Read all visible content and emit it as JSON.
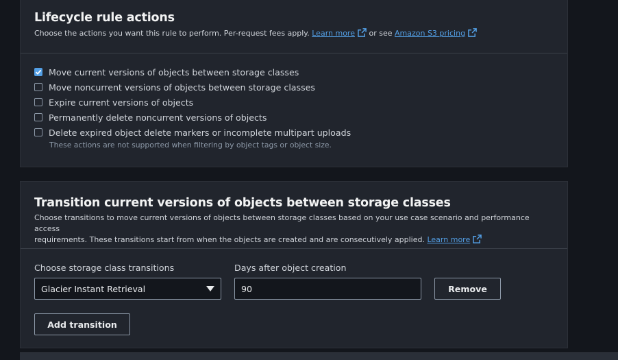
{
  "actions": {
    "title": "Lifecycle rule actions",
    "description_prefix": "Choose the actions you want this rule to perform. Per-request fees apply. ",
    "learn_more": "Learn more",
    "or_see": " or see ",
    "pricing_link": "Amazon S3 pricing",
    "options": [
      {
        "label": "Move current versions of objects between storage classes",
        "checked": true
      },
      {
        "label": "Move noncurrent versions of objects between storage classes",
        "checked": false
      },
      {
        "label": "Expire current versions of objects",
        "checked": false
      },
      {
        "label": "Permanently delete noncurrent versions of objects",
        "checked": false
      },
      {
        "label": "Delete expired object delete markers or incomplete multipart uploads",
        "checked": false
      }
    ],
    "hint": "These actions are not supported when filtering by object tags or object size."
  },
  "transition": {
    "title": "Transition current versions of objects between storage classes",
    "description_line1": "Choose transitions to move current versions of objects between storage classes based on your use case scenario and performance access",
    "description_line2": "requirements. These transitions start from when the objects are created and are consecutively applied. ",
    "learn_more": "Learn more",
    "storage_class_label": "Choose storage class transitions",
    "storage_class_value": "Glacier Instant Retrieval",
    "days_label": "Days after object creation",
    "days_value": "90",
    "remove_label": "Remove",
    "add_label": "Add transition"
  },
  "colors": {
    "accent": "#539fe5",
    "panel": "#21252d",
    "background": "#13161c"
  },
  "icons": [
    "external-link-icon",
    "checkmark-icon",
    "caret-down-icon"
  ]
}
